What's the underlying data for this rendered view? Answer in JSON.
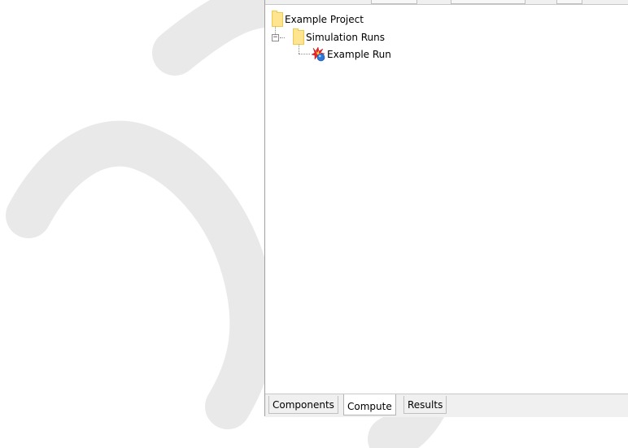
{
  "tree": {
    "root": {
      "label": "Example Project",
      "icon": "folder-icon"
    },
    "folder": {
      "label": "Simulation Runs",
      "icon": "folder-icon",
      "expander": "⊟"
    },
    "run": {
      "label": "Example Run",
      "icon": "simulation-run-icon"
    }
  },
  "tabs": [
    {
      "label": "Components",
      "active": false
    },
    {
      "label": "Compute",
      "active": true
    },
    {
      "label": "Results",
      "active": false
    }
  ],
  "colors": {
    "folder_fill": "#ffe58f",
    "folder_border": "#f0c84c",
    "tab_bar": "#f0f0f0",
    "watermark": "#e9e9e9"
  }
}
